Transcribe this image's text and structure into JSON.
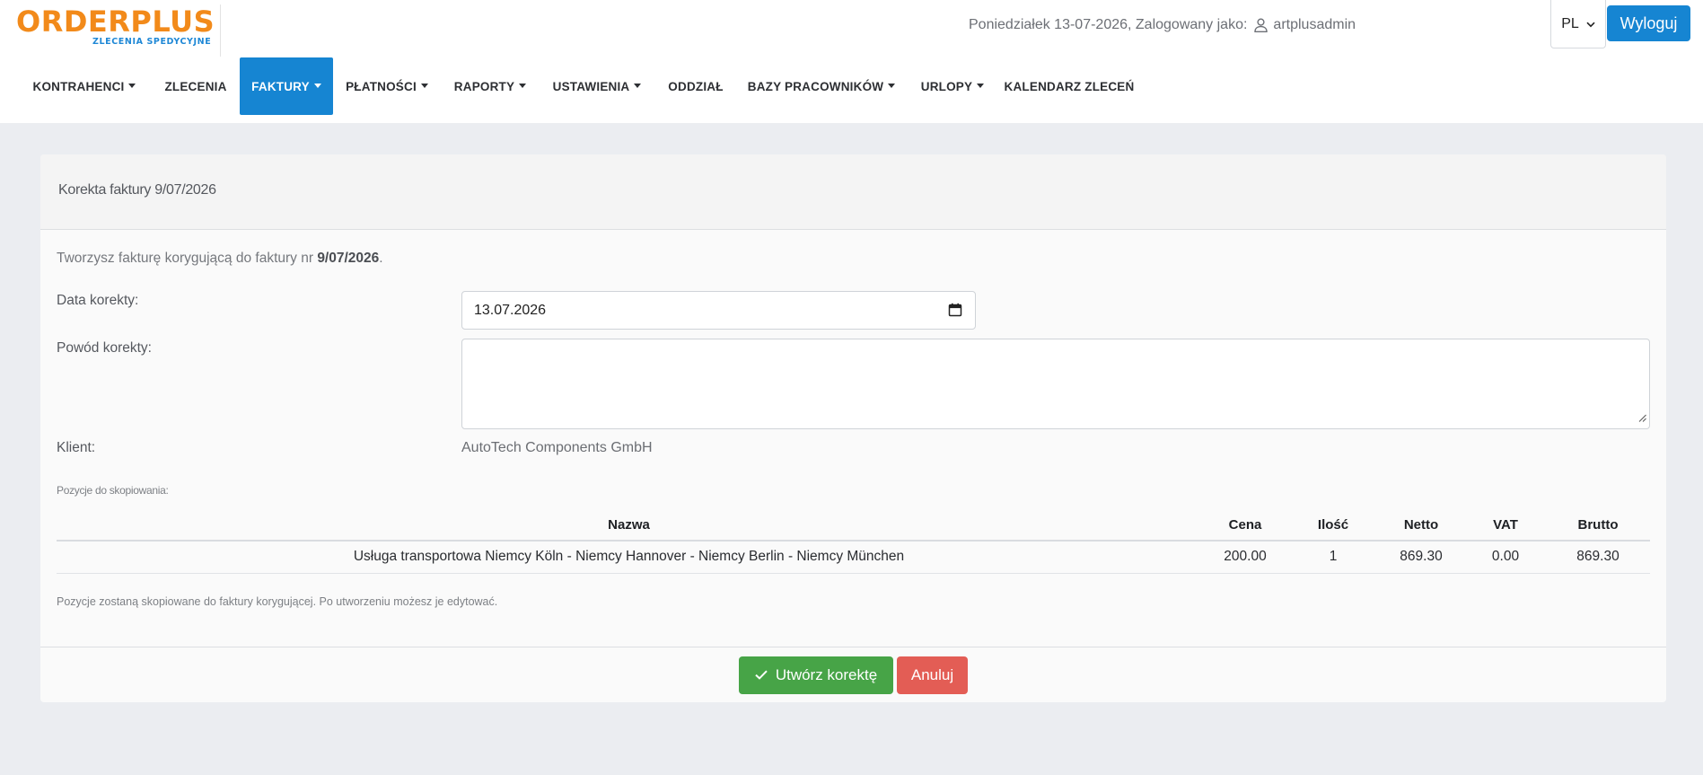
{
  "logo": {
    "main": "ORDERPLUS",
    "sub": "ZLECENIA SPEDYCYJNE"
  },
  "header": {
    "date_text": "Poniedziałek 13-07-2026, Zalogowany jako:",
    "username": "artplusadmin",
    "user_icon": "user-icon",
    "language": "PL",
    "logout_label": "Wyloguj"
  },
  "nav": {
    "items": [
      {
        "label": "KONTRAHENCI",
        "dropdown": true
      },
      {
        "label": "ZLECENIA",
        "dropdown": false
      },
      {
        "label": "FAKTURY",
        "dropdown": true,
        "active": true
      },
      {
        "label": "PŁATNOŚCI",
        "dropdown": true
      },
      {
        "label": "RAPORTY",
        "dropdown": true
      },
      {
        "label": "USTAWIENIA",
        "dropdown": true
      },
      {
        "label": "ODDZIAŁ",
        "dropdown": false
      },
      {
        "label": "BAZY PRACOWNIKÓW",
        "dropdown": true
      },
      {
        "label": "URLOPY",
        "dropdown": true
      },
      {
        "label": "KALENDARZ ZLECEŃ",
        "dropdown": false
      }
    ]
  },
  "form": {
    "title": "Korekta faktury 9/07/2026",
    "intro_prefix": "Tworzysz fakturę korygującą do faktury nr ",
    "intro_invoice": "9/07/2026",
    "intro_suffix": ".",
    "date_label": "Data korekty:",
    "date_value": "13.07.2026",
    "reason_label": "Powód korekty:",
    "reason_value": "",
    "client_label": "Klient:",
    "client_value": "AutoTech Components GmbH",
    "positions_caption": "Pozycje do skopiowania:",
    "table": {
      "headers": [
        "Nazwa",
        "Cena",
        "Ilość",
        "Netto",
        "VAT",
        "Brutto"
      ],
      "rows": [
        [
          "Usługa transportowa Niemcy Köln - Niemcy Hannover - Niemcy Berlin - Niemcy München",
          "200.00",
          "1",
          "869.30",
          "0.00",
          "869.30"
        ]
      ]
    },
    "note": "Pozycje zostaną skopiowane do faktury korygującej. Po utworzeniu możesz je edytować.",
    "create_label": "Utwórz korektę",
    "cancel_label": "Anuluj"
  },
  "colors": {
    "brand_orange": "#f28a1a",
    "brand_blue": "#1685d2",
    "success": "#47a447",
    "danger": "#e35d55"
  }
}
